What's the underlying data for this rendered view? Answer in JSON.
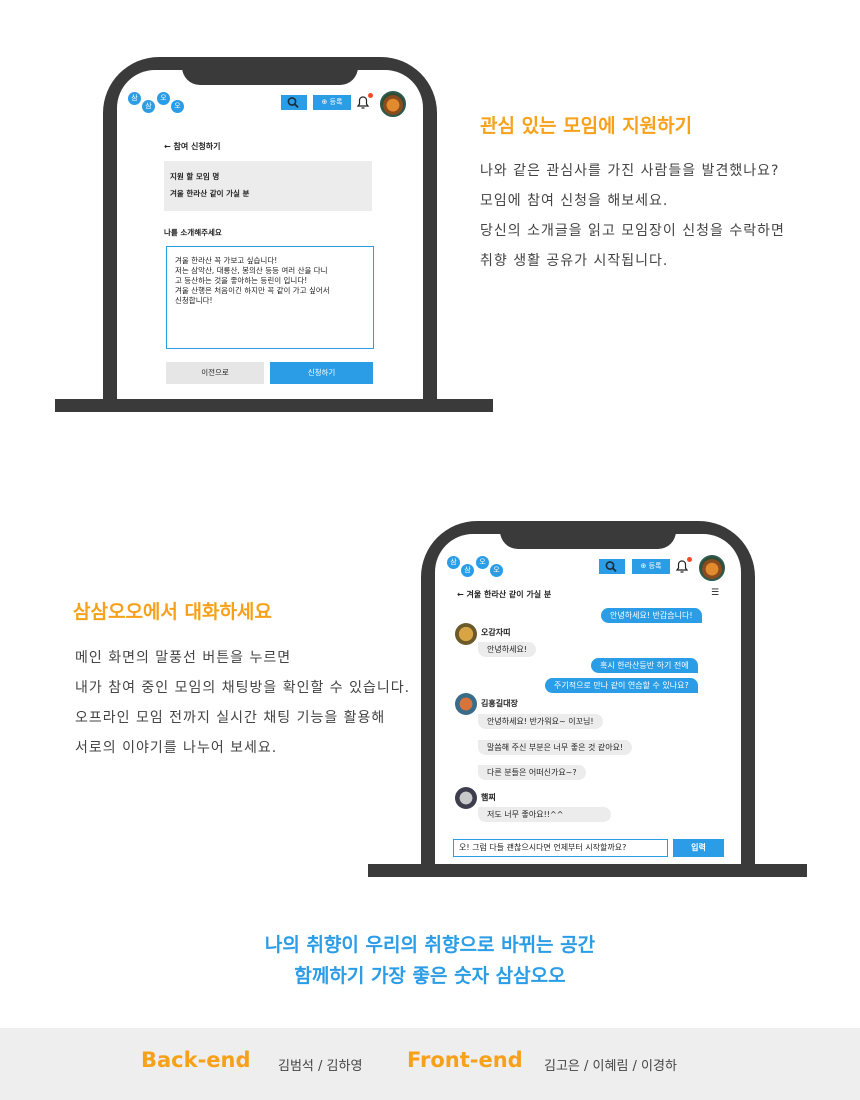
{
  "colors": {
    "accent_orange": "#f7a11a",
    "accent_blue": "#2b9ce6",
    "frame": "#3a3a3a",
    "footer_bg": "#eeeeee"
  },
  "phone1": {
    "logo_chars": [
      "삼",
      "삼",
      "오",
      "오"
    ],
    "register_label": "등록",
    "back_label": "← 참여 신청하기",
    "meeting_name_label": "지원 할 모임 명",
    "meeting_name_value": "겨울 한라산 같이 가실 분",
    "intro_label": "나를 소개해주세요",
    "intro_lines": [
      "겨울 한라산 꼭 가보고 싶습니다!",
      "저는 삼악산, 대룡산, 봉의산 등등 여러 산을 다니",
      "고 등산하는 것을 좋아하는 등린이 입니다!",
      "겨울 산행은 처음이긴 하지만 꼭 같이 가고 싶어서",
      "신청합니다!"
    ],
    "prev_button": "이전으로",
    "apply_button": "신청하기"
  },
  "section1": {
    "title": "관심 있는 모임에 지원하기",
    "lines": [
      "나와 같은 관심사를 가진 사람들을 발견했나요?",
      "모임에 참여 신청을 해보세요.",
      "당신의 소개글을 읽고 모임장이 신청을 수락하면",
      "취향 생활 공유가 시작됩니다."
    ]
  },
  "section2": {
    "title": "삼삼오오에서 대화하세요",
    "lines": [
      "메인 화면의 말풍선 버튼을 누르면",
      "내가 참여 중인 모임의 채팅방을 확인할 수 있습니다.",
      "오프라인 모임 전까지 실시간 채팅 기능을 활용해",
      "서로의 이야기를 나누어 보세요."
    ]
  },
  "phone2": {
    "logo_chars": [
      "삼",
      "삼",
      "오",
      "오"
    ],
    "register_label": "등록",
    "chat_title": "← 겨울 한라산 같이 가실 분",
    "menu_icon": "☰",
    "messages_right_1": "안녕하세요! 반갑습니다!",
    "user1_name": "오감자띠",
    "user1_msg": "안녕하세요!",
    "messages_right_2": "혹시 한라산등반 하기 전에",
    "messages_right_3": "주기적으로 만나 같이 연습할 수 있나요?",
    "user2_name": "김홍길대장",
    "user2_msgs": [
      "안녕하세요! 반가워요~ 이꼬님!",
      "말씀해 주신 부분은 너무 좋은 것 같아요!",
      "다른 분들은 어떠신가요~?"
    ],
    "user3_name": "햄찌",
    "user3_msg": "저도 너무 좋아요!!^^",
    "input_value": "오! 그럼 다들 괜찮으시다면 언제부터 시작할까요?",
    "send_button": "입력"
  },
  "tagline": {
    "line1": "나의 취향이 우리의 취향으로 바뀌는 공간",
    "line2": "함께하기 가장 좋은 숫자 삼삼오오"
  },
  "footer": {
    "backend_label": "Back-end",
    "backend_names": "김범석 / 김하영",
    "frontend_label": "Front-end",
    "frontend_names": "김고은 / 이혜림 / 이경하"
  }
}
